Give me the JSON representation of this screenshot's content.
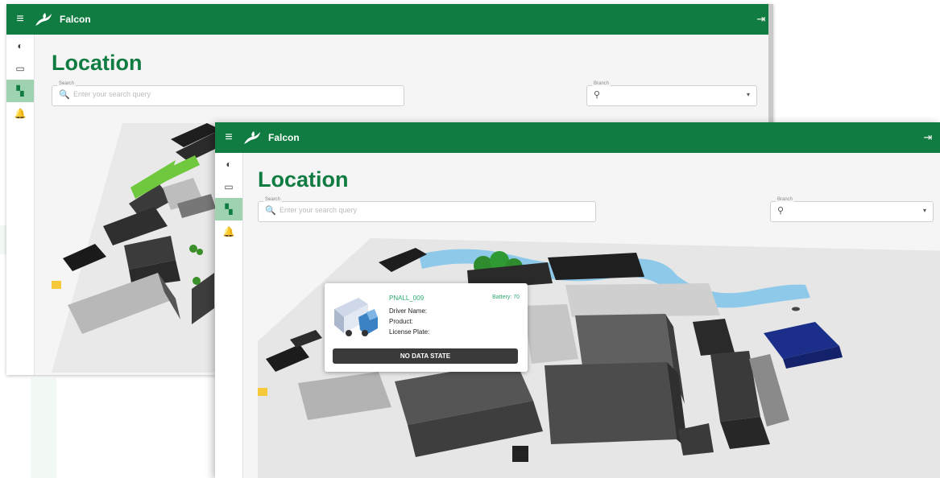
{
  "app": {
    "title": "Falcon",
    "brand_color": "#107c41"
  },
  "icons": {
    "menu": "≡",
    "logout": "⇥",
    "dashboard": "◐",
    "devices": "▭",
    "location": "▚",
    "alerts": "🔔",
    "search": "🔍",
    "pin": "⚲",
    "dropdown": "▾"
  },
  "page": {
    "title": "Location"
  },
  "search": {
    "label": "Search",
    "placeholder": "Enter your search query"
  },
  "branch": {
    "label": "Branch"
  },
  "popup": {
    "vehicle_id": "PNALL_009",
    "battery": "Battery: 70",
    "driver_label": "Driver Name:",
    "product_label": "Product:",
    "plate_label": "License Plate:",
    "status_button": "NO DATA STATE"
  }
}
